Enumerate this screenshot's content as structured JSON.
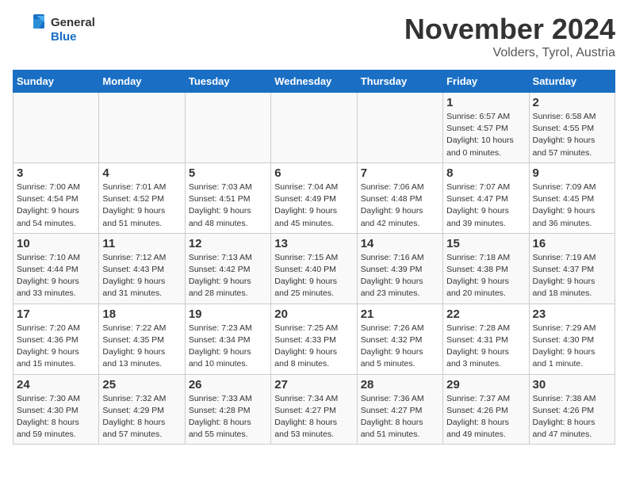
{
  "header": {
    "logo_line1": "General",
    "logo_line2": "Blue",
    "month": "November 2024",
    "location": "Volders, Tyrol, Austria"
  },
  "weekdays": [
    "Sunday",
    "Monday",
    "Tuesday",
    "Wednesday",
    "Thursday",
    "Friday",
    "Saturday"
  ],
  "weeks": [
    [
      {
        "day": "",
        "info": ""
      },
      {
        "day": "",
        "info": ""
      },
      {
        "day": "",
        "info": ""
      },
      {
        "day": "",
        "info": ""
      },
      {
        "day": "",
        "info": ""
      },
      {
        "day": "1",
        "info": "Sunrise: 6:57 AM\nSunset: 4:57 PM\nDaylight: 10 hours\nand 0 minutes."
      },
      {
        "day": "2",
        "info": "Sunrise: 6:58 AM\nSunset: 4:55 PM\nDaylight: 9 hours\nand 57 minutes."
      }
    ],
    [
      {
        "day": "3",
        "info": "Sunrise: 7:00 AM\nSunset: 4:54 PM\nDaylight: 9 hours\nand 54 minutes."
      },
      {
        "day": "4",
        "info": "Sunrise: 7:01 AM\nSunset: 4:52 PM\nDaylight: 9 hours\nand 51 minutes."
      },
      {
        "day": "5",
        "info": "Sunrise: 7:03 AM\nSunset: 4:51 PM\nDaylight: 9 hours\nand 48 minutes."
      },
      {
        "day": "6",
        "info": "Sunrise: 7:04 AM\nSunset: 4:49 PM\nDaylight: 9 hours\nand 45 minutes."
      },
      {
        "day": "7",
        "info": "Sunrise: 7:06 AM\nSunset: 4:48 PM\nDaylight: 9 hours\nand 42 minutes."
      },
      {
        "day": "8",
        "info": "Sunrise: 7:07 AM\nSunset: 4:47 PM\nDaylight: 9 hours\nand 39 minutes."
      },
      {
        "day": "9",
        "info": "Sunrise: 7:09 AM\nSunset: 4:45 PM\nDaylight: 9 hours\nand 36 minutes."
      }
    ],
    [
      {
        "day": "10",
        "info": "Sunrise: 7:10 AM\nSunset: 4:44 PM\nDaylight: 9 hours\nand 33 minutes."
      },
      {
        "day": "11",
        "info": "Sunrise: 7:12 AM\nSunset: 4:43 PM\nDaylight: 9 hours\nand 31 minutes."
      },
      {
        "day": "12",
        "info": "Sunrise: 7:13 AM\nSunset: 4:42 PM\nDaylight: 9 hours\nand 28 minutes."
      },
      {
        "day": "13",
        "info": "Sunrise: 7:15 AM\nSunset: 4:40 PM\nDaylight: 9 hours\nand 25 minutes."
      },
      {
        "day": "14",
        "info": "Sunrise: 7:16 AM\nSunset: 4:39 PM\nDaylight: 9 hours\nand 23 minutes."
      },
      {
        "day": "15",
        "info": "Sunrise: 7:18 AM\nSunset: 4:38 PM\nDaylight: 9 hours\nand 20 minutes."
      },
      {
        "day": "16",
        "info": "Sunrise: 7:19 AM\nSunset: 4:37 PM\nDaylight: 9 hours\nand 18 minutes."
      }
    ],
    [
      {
        "day": "17",
        "info": "Sunrise: 7:20 AM\nSunset: 4:36 PM\nDaylight: 9 hours\nand 15 minutes."
      },
      {
        "day": "18",
        "info": "Sunrise: 7:22 AM\nSunset: 4:35 PM\nDaylight: 9 hours\nand 13 minutes."
      },
      {
        "day": "19",
        "info": "Sunrise: 7:23 AM\nSunset: 4:34 PM\nDaylight: 9 hours\nand 10 minutes."
      },
      {
        "day": "20",
        "info": "Sunrise: 7:25 AM\nSunset: 4:33 PM\nDaylight: 9 hours\nand 8 minutes."
      },
      {
        "day": "21",
        "info": "Sunrise: 7:26 AM\nSunset: 4:32 PM\nDaylight: 9 hours\nand 5 minutes."
      },
      {
        "day": "22",
        "info": "Sunrise: 7:28 AM\nSunset: 4:31 PM\nDaylight: 9 hours\nand 3 minutes."
      },
      {
        "day": "23",
        "info": "Sunrise: 7:29 AM\nSunset: 4:30 PM\nDaylight: 9 hours\nand 1 minute."
      }
    ],
    [
      {
        "day": "24",
        "info": "Sunrise: 7:30 AM\nSunset: 4:30 PM\nDaylight: 8 hours\nand 59 minutes."
      },
      {
        "day": "25",
        "info": "Sunrise: 7:32 AM\nSunset: 4:29 PM\nDaylight: 8 hours\nand 57 minutes."
      },
      {
        "day": "26",
        "info": "Sunrise: 7:33 AM\nSunset: 4:28 PM\nDaylight: 8 hours\nand 55 minutes."
      },
      {
        "day": "27",
        "info": "Sunrise: 7:34 AM\nSunset: 4:27 PM\nDaylight: 8 hours\nand 53 minutes."
      },
      {
        "day": "28",
        "info": "Sunrise: 7:36 AM\nSunset: 4:27 PM\nDaylight: 8 hours\nand 51 minutes."
      },
      {
        "day": "29",
        "info": "Sunrise: 7:37 AM\nSunset: 4:26 PM\nDaylight: 8 hours\nand 49 minutes."
      },
      {
        "day": "30",
        "info": "Sunrise: 7:38 AM\nSunset: 4:26 PM\nDaylight: 8 hours\nand 47 minutes."
      }
    ]
  ]
}
